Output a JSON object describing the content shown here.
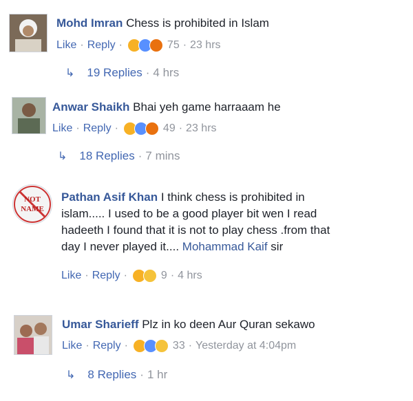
{
  "comments": [
    {
      "name": "Mohd Imran",
      "text": "Chess is prohibited in Islam",
      "actions": {
        "like": "Like",
        "reply": "Reply",
        "reactions_count": "75",
        "time": "23 hrs",
        "reaction_types": [
          "haha-icon",
          "wow-icon",
          "angry-icon"
        ]
      },
      "replies": {
        "label": "19 Replies",
        "time": "4 hrs"
      }
    },
    {
      "name": "Anwar Shaikh",
      "text": "Bhai yeh game harraaam he",
      "actions": {
        "like": "Like",
        "reply": "Reply",
        "reactions_count": "49",
        "time": "23 hrs",
        "reaction_types": [
          "haha-icon",
          "wow-icon",
          "angry-icon"
        ]
      },
      "replies": {
        "label": "18 Replies",
        "time": "7 mins"
      }
    },
    {
      "name": "Pathan Asif Khan",
      "text_line1": "I think chess is prohibited in",
      "text_line2": "islam..... I used to be a good player bit wen I read",
      "text_line3": "hadeeth I found that it is not to play chess .from that",
      "text_line4_prefix": "day I never played it....",
      "mention": "Mohammad Kaif",
      "text_line4_suffix": "sir",
      "avatar_text_top": "NOT",
      "avatar_text_bottom": "NAME",
      "actions": {
        "like": "Like",
        "reply": "Reply",
        "reactions_count": "9",
        "time": "4 hrs",
        "reaction_types": [
          "haha-icon",
          "sad-icon"
        ]
      }
    },
    {
      "name": "Umar Sharieff",
      "text": "Plz in ko deen Aur Quran sekawo",
      "actions": {
        "like": "Like",
        "reply": "Reply",
        "reactions_count": "33",
        "time": "Yesterday at 4:04pm",
        "reaction_types": [
          "haha-icon",
          "wow-icon",
          "sad-icon"
        ]
      },
      "replies": {
        "label": "8 Replies",
        "time": "1 hr"
      }
    }
  ],
  "separator": "·",
  "reply_arrow": "↳",
  "colors": {
    "link": "#365899",
    "meta": "#90949c",
    "haha": "#f7b125",
    "wow": "#5890ff",
    "angry": "#e9710f"
  }
}
